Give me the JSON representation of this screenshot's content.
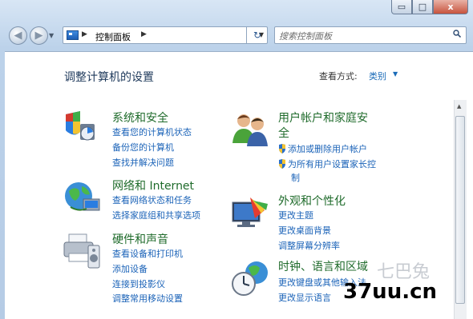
{
  "window": {
    "caption": {
      "minimize_glyph": "▭",
      "maximize_glyph": "□",
      "close_glyph": "x"
    }
  },
  "nav": {
    "back_glyph": "◀",
    "forward_glyph": "▶",
    "dropdown_glyph": "▼"
  },
  "address": {
    "separator": "▶",
    "location": "控制面板",
    "dropdown_glyph": "▼",
    "refresh_glyph": "↻"
  },
  "search": {
    "placeholder": "搜索控制面板"
  },
  "content": {
    "title": "调整计算机的设置",
    "view_by_label": "查看方式:",
    "view_by_value": "类别",
    "view_by_drop": "▼"
  },
  "categories": {
    "system": {
      "title": "系统和安全",
      "links": [
        "查看您的计算机状态",
        "备份您的计算机",
        "查找并解决问题"
      ]
    },
    "network": {
      "title": "网络和 Internet",
      "links": [
        "查看网络状态和任务",
        "选择家庭组和共享选项"
      ]
    },
    "hardware": {
      "title": "硬件和声音",
      "links": [
        "查看设备和打印机",
        "添加设备",
        "连接到投影仪",
        "调整常用移动设置"
      ]
    },
    "users": {
      "title_line1": "用户帐户和家庭安",
      "title_line2": "全",
      "links": [
        "添加或删除用户帐户",
        "为所有用户设置家长控",
        "制"
      ]
    },
    "appearance": {
      "title": "外观和个性化",
      "links": [
        "更改主题",
        "更改桌面背景",
        "调整屏幕分辨率"
      ]
    },
    "clock": {
      "title": "时钟、语言和区域",
      "links": [
        "更改键盘或其他输入法",
        "更改显示语言"
      ]
    }
  },
  "watermark": {
    "text": "37uu.cn",
    "ghost": "七巴兔"
  }
}
